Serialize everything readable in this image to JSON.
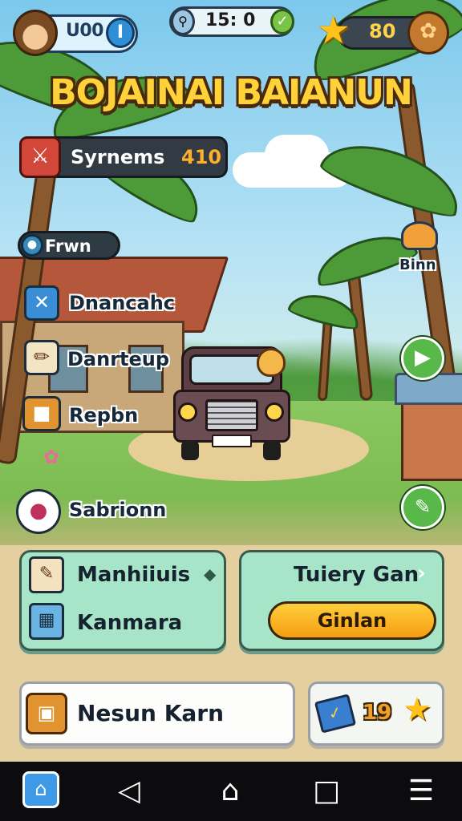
{
  "hud": {
    "avatar_coins": "U00",
    "pill_button": "I",
    "timer": "15: 0",
    "stars": "80"
  },
  "title": "BOJAINAI BAIANUN",
  "score": {
    "label": "Syrnems",
    "value": "410"
  },
  "side_menu": {
    "pill": "Frwn",
    "items": [
      {
        "label": "Dnancahc",
        "icon": "close-x-icon"
      },
      {
        "label": "Danrteup",
        "icon": "brush-icon"
      },
      {
        "label": "Repbn",
        "icon": "bucket-icon"
      }
    ],
    "extra": "Sabrionn"
  },
  "right_menu": {
    "bin_label": "Binn"
  },
  "panels": {
    "left": [
      {
        "label": "Manhiiuis",
        "icon": "map-scroll-icon"
      },
      {
        "label": "Kanmara",
        "icon": "grid-calendar-icon"
      }
    ],
    "right_title": "Tuiery Gan",
    "right_button": "Ginlan"
  },
  "bottom": {
    "left_label": "Nesun Karn",
    "right_value": "19"
  },
  "colors": {
    "title_yellow": "#ffd23a",
    "panel_mint": "#a7e5c8",
    "button_orange": "#f5a51a",
    "score_orange": "#ffb02a"
  }
}
